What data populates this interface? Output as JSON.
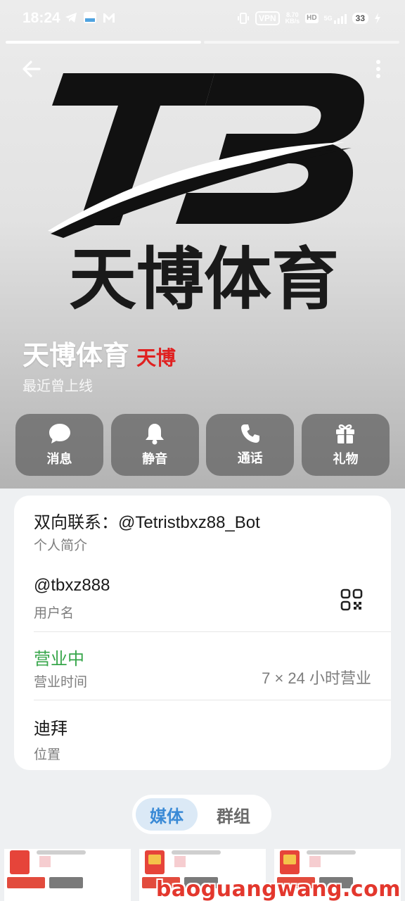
{
  "status_bar": {
    "time": "18:24",
    "vpn_label": "VPN",
    "speed_value": "8.70",
    "speed_unit": "KB/s",
    "hd_label": "HD",
    "network_label": "5G",
    "battery_level": "33"
  },
  "story": {
    "segments": 2,
    "active_index": 0
  },
  "profile": {
    "name": "天博体育",
    "tag": "天博",
    "last_seen": "最近曾上线",
    "logo_letters": "TB",
    "logo_text": "天博体育"
  },
  "actions": [
    {
      "id": "message",
      "label": "消息",
      "icon": "chat-bubble-icon"
    },
    {
      "id": "mute",
      "label": "静音",
      "icon": "bell-icon"
    },
    {
      "id": "call",
      "label": "通话",
      "icon": "phone-icon"
    },
    {
      "id": "gift",
      "label": "礼物",
      "icon": "gift-icon"
    }
  ],
  "info": {
    "bio": {
      "value": "双向联系：@Tetristbxz88_Bot",
      "label": "个人简介"
    },
    "username": {
      "value": "@tbxz888",
      "label": "用户名",
      "icon": "qr-code-icon"
    },
    "business_hours": {
      "value": "营业中",
      "label": "营业时间",
      "detail": "7 × 24 小时营业",
      "status_color": "#37a64a"
    },
    "location": {
      "value": "迪拜",
      "label": "位置"
    }
  },
  "tabs": [
    {
      "label": "媒体",
      "active": true
    },
    {
      "label": "群组",
      "active": false
    }
  ],
  "watermark": "baoguangwang.com",
  "colors": {
    "accent_blue": "#3a8ad6",
    "brand_red": "#e02020",
    "card_bg": "#ffffff"
  }
}
